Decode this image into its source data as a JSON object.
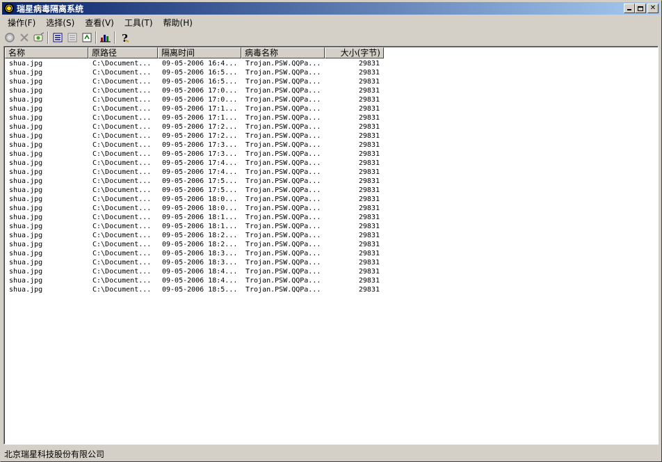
{
  "window": {
    "title": "瑞星病毒隔离系统"
  },
  "menu": [
    {
      "label": "操作(F)"
    },
    {
      "label": "选择(S)"
    },
    {
      "label": "查看(V)"
    },
    {
      "label": "工具(T)"
    },
    {
      "label": "帮助(H)"
    }
  ],
  "toolbar": {
    "icons": [
      "restore-icon",
      "delete-icon",
      "scan-icon",
      "view-list-icon",
      "view-details-icon",
      "view-report-icon",
      "statistics-icon",
      "help-icon"
    ]
  },
  "table": {
    "columns": [
      "名称",
      "原路径",
      "隔离时间",
      "病毒名称",
      "大小(字节)"
    ],
    "rows": [
      [
        "shua.jpg",
        "C:\\Document...",
        "09-05-2006 16:4...",
        "Trojan.PSW.QQPa...",
        "29831"
      ],
      [
        "shua.jpg",
        "C:\\Document...",
        "09-05-2006 16:5...",
        "Trojan.PSW.QQPa...",
        "29831"
      ],
      [
        "shua.jpg",
        "C:\\Document...",
        "09-05-2006 16:5...",
        "Trojan.PSW.QQPa...",
        "29831"
      ],
      [
        "shua.jpg",
        "C:\\Document...",
        "09-05-2006 17:0...",
        "Trojan.PSW.QQPa...",
        "29831"
      ],
      [
        "shua.jpg",
        "C:\\Document...",
        "09-05-2006 17:0...",
        "Trojan.PSW.QQPa...",
        "29831"
      ],
      [
        "shua.jpg",
        "C:\\Document...",
        "09-05-2006 17:1...",
        "Trojan.PSW.QQPa...",
        "29831"
      ],
      [
        "shua.jpg",
        "C:\\Document...",
        "09-05-2006 17:1...",
        "Trojan.PSW.QQPa...",
        "29831"
      ],
      [
        "shua.jpg",
        "C:\\Document...",
        "09-05-2006 17:2...",
        "Trojan.PSW.QQPa...",
        "29831"
      ],
      [
        "shua.jpg",
        "C:\\Document...",
        "09-05-2006 17:2...",
        "Trojan.PSW.QQPa...",
        "29831"
      ],
      [
        "shua.jpg",
        "C:\\Document...",
        "09-05-2006 17:3...",
        "Trojan.PSW.QQPa...",
        "29831"
      ],
      [
        "shua.jpg",
        "C:\\Document...",
        "09-05-2006 17:3...",
        "Trojan.PSW.QQPa...",
        "29831"
      ],
      [
        "shua.jpg",
        "C:\\Document...",
        "09-05-2006 17:4...",
        "Trojan.PSW.QQPa...",
        "29831"
      ],
      [
        "shua.jpg",
        "C:\\Document...",
        "09-05-2006 17:4...",
        "Trojan.PSW.QQPa...",
        "29831"
      ],
      [
        "shua.jpg",
        "C:\\Document...",
        "09-05-2006 17:5...",
        "Trojan.PSW.QQPa...",
        "29831"
      ],
      [
        "shua.jpg",
        "C:\\Document...",
        "09-05-2006 17:5...",
        "Trojan.PSW.QQPa...",
        "29831"
      ],
      [
        "shua.jpg",
        "C:\\Document...",
        "09-05-2006 18:0...",
        "Trojan.PSW.QQPa...",
        "29831"
      ],
      [
        "shua.jpg",
        "C:\\Document...",
        "09-05-2006 18:0...",
        "Trojan.PSW.QQPa...",
        "29831"
      ],
      [
        "shua.jpg",
        "C:\\Document...",
        "09-05-2006 18:1...",
        "Trojan.PSW.QQPa...",
        "29831"
      ],
      [
        "shua.jpg",
        "C:\\Document...",
        "09-05-2006 18:1...",
        "Trojan.PSW.QQPa...",
        "29831"
      ],
      [
        "shua.jpg",
        "C:\\Document...",
        "09-05-2006 18:2...",
        "Trojan.PSW.QQPa...",
        "29831"
      ],
      [
        "shua.jpg",
        "C:\\Document...",
        "09-05-2006 18:2...",
        "Trojan.PSW.QQPa...",
        "29831"
      ],
      [
        "shua.jpg",
        "C:\\Document...",
        "09-05-2006 18:3...",
        "Trojan.PSW.QQPa...",
        "29831"
      ],
      [
        "shua.jpg",
        "C:\\Document...",
        "09-05-2006 18:3...",
        "Trojan.PSW.QQPa...",
        "29831"
      ],
      [
        "shua.jpg",
        "C:\\Document...",
        "09-05-2006 18:4...",
        "Trojan.PSW.QQPa...",
        "29831"
      ],
      [
        "shua.jpg",
        "C:\\Document...",
        "09-05-2006 18:4...",
        "Trojan.PSW.QQPa...",
        "29831"
      ],
      [
        "shua.jpg",
        "C:\\Document...",
        "09-05-2006 18:5...",
        "Trojan.PSW.QQPa...",
        "29831"
      ]
    ]
  },
  "status": {
    "text": "北京瑞星科技股份有限公司"
  },
  "colors": {
    "titlebar_start": "#0a246a",
    "titlebar_end": "#a6caf0",
    "face": "#d4d0c8"
  }
}
